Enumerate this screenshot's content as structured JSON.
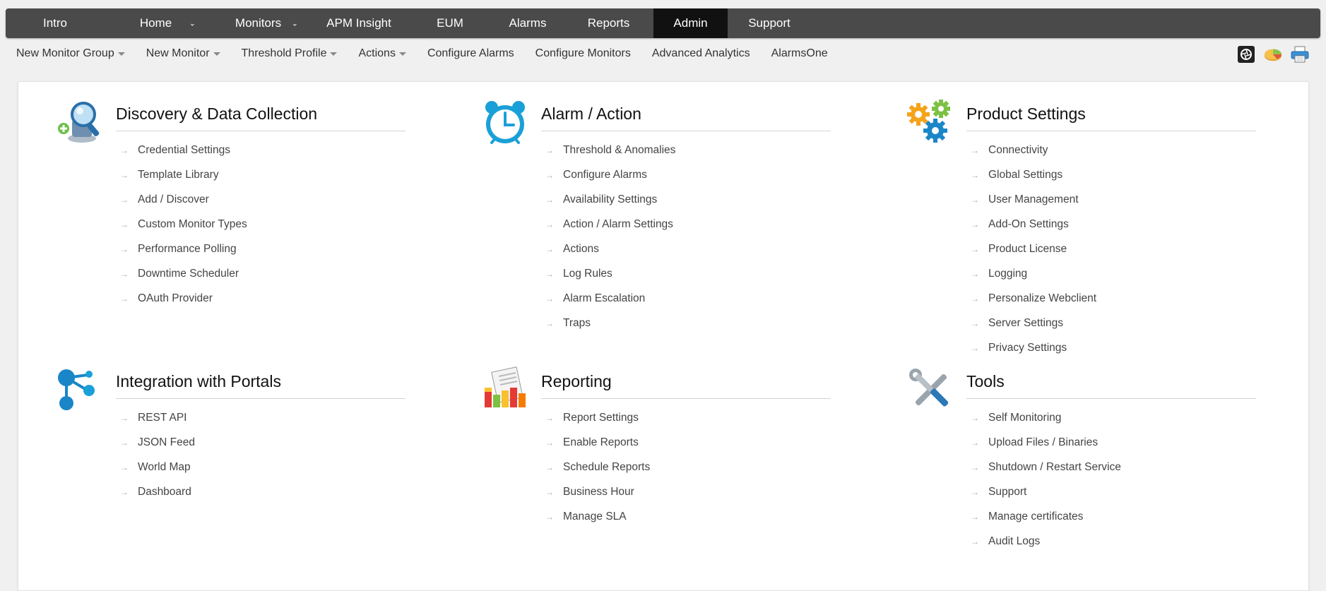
{
  "topnav": {
    "tabs": [
      {
        "label": "Intro",
        "has_dropdown": false,
        "active": false
      },
      {
        "label": "Home",
        "has_dropdown": true,
        "active": false
      },
      {
        "label": "Monitors",
        "has_dropdown": true,
        "active": false
      },
      {
        "label": "APM Insight",
        "has_dropdown": false,
        "active": false
      },
      {
        "label": "EUM",
        "has_dropdown": false,
        "active": false
      },
      {
        "label": "Alarms",
        "has_dropdown": false,
        "active": false
      },
      {
        "label": "Reports",
        "has_dropdown": false,
        "active": false
      },
      {
        "label": "Admin",
        "has_dropdown": false,
        "active": true
      },
      {
        "label": "Support",
        "has_dropdown": false,
        "active": false
      }
    ]
  },
  "subnav": {
    "items": [
      {
        "label": "New Monitor Group",
        "has_dropdown": true
      },
      {
        "label": "New Monitor",
        "has_dropdown": true
      },
      {
        "label": "Threshold Profile",
        "has_dropdown": true
      },
      {
        "label": "Actions",
        "has_dropdown": true
      },
      {
        "label": "Configure Alarms",
        "has_dropdown": false
      },
      {
        "label": "Configure Monitors",
        "has_dropdown": false
      },
      {
        "label": "Advanced Analytics",
        "has_dropdown": false
      },
      {
        "label": "AlarmsOne",
        "has_dropdown": false
      }
    ],
    "icons": [
      "camera-icon",
      "pie-chart-icon",
      "printer-icon"
    ]
  },
  "sections": [
    {
      "title": "Discovery & Data Collection",
      "icon": "discovery-icon",
      "links": [
        "Credential Settings",
        "Template Library",
        "Add / Discover",
        "Custom Monitor Types",
        "Performance Polling",
        "Downtime Scheduler",
        "OAuth Provider"
      ]
    },
    {
      "title": "Alarm / Action",
      "icon": "alarm-clock-icon",
      "links": [
        "Threshold & Anomalies",
        "Configure Alarms",
        "Availability Settings",
        "Action / Alarm Settings",
        "Actions",
        "Log Rules",
        "Alarm Escalation",
        "Traps"
      ]
    },
    {
      "title": "Product Settings",
      "icon": "gears-icon",
      "links": [
        "Connectivity",
        "Global Settings",
        "User Management",
        "Add-On Settings",
        "Product License",
        "Logging",
        "Personalize Webclient",
        "Server Settings",
        "Privacy Settings"
      ]
    },
    {
      "title": "Integration with Portals",
      "icon": "integration-icon",
      "links": [
        "REST API",
        "JSON Feed",
        "World Map",
        "Dashboard"
      ]
    },
    {
      "title": "Reporting",
      "icon": "reporting-icon",
      "links": [
        "Report Settings",
        "Enable Reports",
        "Schedule Reports",
        "Business Hour",
        "Manage SLA"
      ]
    },
    {
      "title": "Tools",
      "icon": "tools-icon",
      "links": [
        "Self Monitoring",
        "Upload Files / Binaries",
        "Shutdown / Restart Service",
        "Support",
        "Manage certificates",
        "Audit Logs"
      ]
    }
  ],
  "colors": {
    "topnav_bg": "#4a4a4a",
    "active_tab_bg": "#111111",
    "accent_blue": "#1aa0d8",
    "gear_orange": "#f5a31a",
    "gear_green": "#7cc142"
  }
}
